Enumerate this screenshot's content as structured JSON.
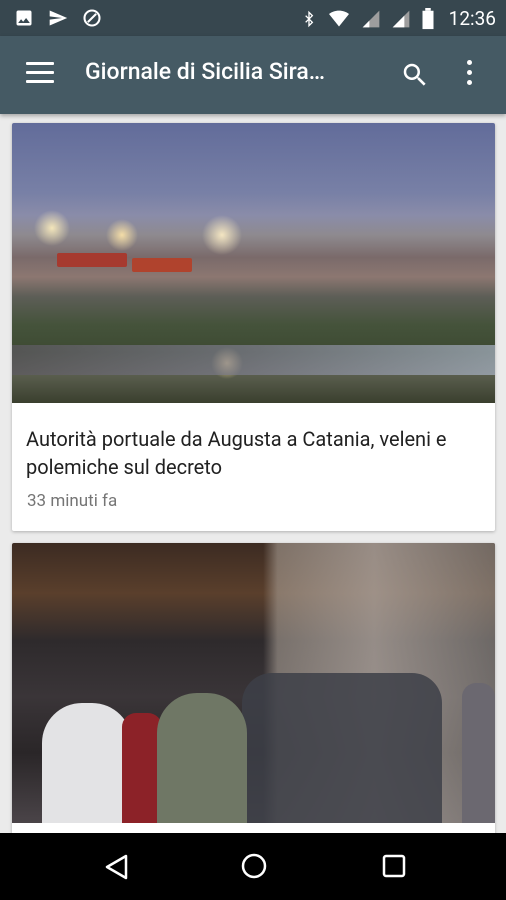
{
  "status_bar": {
    "time": "12:36",
    "left_icons": [
      "image-icon",
      "send-icon",
      "shield-icon"
    ],
    "right_icons": [
      "bluetooth-icon",
      "wifi-icon",
      "signal-icon",
      "signal-icon",
      "battery-icon"
    ]
  },
  "toolbar": {
    "title": "Giornale di Sicilia Sira…",
    "menu_icon": "menu-icon",
    "search_icon": "search-icon",
    "more_icon": "more-vert-icon",
    "colors": {
      "background": "#455a64",
      "status_bar": "#37474f"
    }
  },
  "feed": {
    "items": [
      {
        "title": "Autorità portuale da Augusta a Catania, veleni e polemiche sul decreto",
        "time": "33 minuti fa"
      },
      {
        "title": "",
        "time": ""
      }
    ]
  },
  "nav_bar": {
    "icons": [
      "back-icon",
      "home-icon",
      "recents-icon"
    ]
  }
}
